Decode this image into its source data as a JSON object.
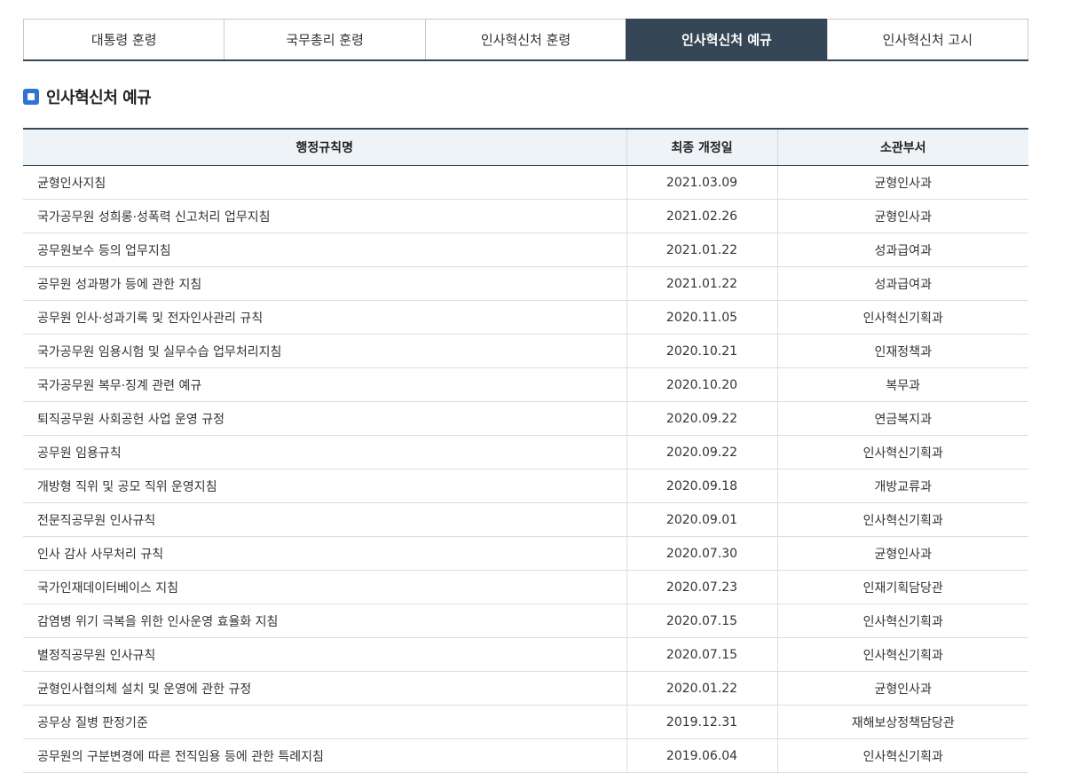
{
  "tabs": [
    {
      "label": "대통령 훈령",
      "active": false
    },
    {
      "label": "국무총리 훈령",
      "active": false
    },
    {
      "label": "인사혁신처 훈령",
      "active": false
    },
    {
      "label": "인사혁신처 예규",
      "active": true
    },
    {
      "label": "인사혁신처 고시",
      "active": false
    }
  ],
  "section": {
    "title": "인사혁신처 예규"
  },
  "table": {
    "headers": [
      "행정규칙명",
      "최종 개정일",
      "소관부서"
    ],
    "rows": [
      [
        "균형인사지침",
        "2021.03.09",
        "균형인사과"
      ],
      [
        "국가공무원 성희롱·성폭력 신고처리 업무지침",
        "2021.02.26",
        "균형인사과"
      ],
      [
        "공무원보수 등의 업무지침",
        "2021.01.22",
        "성과급여과"
      ],
      [
        "공무원 성과평가 등에 관한 지침",
        "2021.01.22",
        "성과급여과"
      ],
      [
        "공무원 인사·성과기록 및 전자인사관리 규칙",
        "2020.11.05",
        "인사혁신기획과"
      ],
      [
        "국가공무원 임용시험 및 실무수습 업무처리지침",
        "2020.10.21",
        "인재정책과"
      ],
      [
        "국가공무원 복무·징계 관련 예규",
        "2020.10.20",
        "복무과"
      ],
      [
        "퇴직공무원 사회공헌 사업 운영 규정",
        "2020.09.22",
        "연금복지과"
      ],
      [
        "공무원 임용규칙",
        "2020.09.22",
        "인사혁신기획과"
      ],
      [
        "개방형 직위 및 공모 직위 운영지침",
        "2020.09.18",
        "개방교류과"
      ],
      [
        "전문직공무원 인사규칙",
        "2020.09.01",
        "인사혁신기획과"
      ],
      [
        "인사 감사 사무처리 규칙",
        "2020.07.30",
        "균형인사과"
      ],
      [
        "국가인재데이터베이스 지침",
        "2020.07.23",
        "인재기획담당관"
      ],
      [
        "감염병 위기 극복을 위한 인사운영 효율화 지침",
        "2020.07.15",
        "인사혁신기획과"
      ],
      [
        "별정직공무원 인사규칙",
        "2020.07.15",
        "인사혁신기획과"
      ],
      [
        "균형인사협의체 설치 및 운영에 관한 규정",
        "2020.01.22",
        "균형인사과"
      ],
      [
        "공무상 질병 판정기준",
        "2019.12.31",
        "재해보상정책담당관"
      ],
      [
        "공무원의 구분변경에 따른 전직임용 등에 관한 특례지침",
        "2019.06.04",
        "인사혁신기획과"
      ]
    ]
  }
}
